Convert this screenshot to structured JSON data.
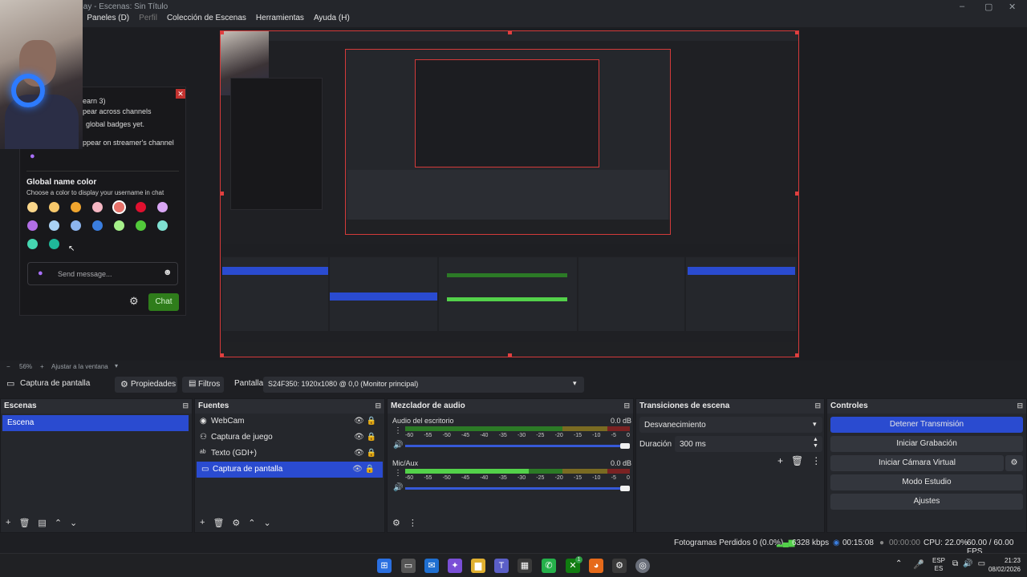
{
  "window": {
    "title_partial": "play - Escenas: Sin Título",
    "menu": [
      "ta",
      "Paneles (D)",
      "Perfil",
      "Colección de Escenas",
      "Herramientas",
      "Ayuda (H)"
    ]
  },
  "chat": {
    "lines": [
      "earn 3)",
      "pear across channels",
      "global badges yet.",
      "ppear on streamer's channel"
    ],
    "name_color_title": "Global name color",
    "name_color_desc": "Choose a color to display your username in chat",
    "swatches": [
      "#fbd78b",
      "#f7c86b",
      "#f0a52e",
      "#f6b7c3",
      "#e8726a",
      "#e0102f",
      "#d9a6f4",
      "#b26ee6",
      "#a9d2f4",
      "#8db5ee",
      "#3a7ee0",
      "#a6f08a",
      "#52c93a",
      "#7fe0d2",
      "#45d6b0",
      "#1fb89a"
    ],
    "send_placeholder": "Send message...",
    "chat_button": "Chat"
  },
  "zoom": {
    "level": "56%",
    "fit_label": "Ajustar a la ventana"
  },
  "source_bar": {
    "source_name": "Captura de pantalla",
    "properties": "Propiedades",
    "filters": "Filtros",
    "display_label": "Pantalla",
    "display_value": "S24F350: 1920x1080 @ 0,0 (Monitor principal)"
  },
  "scenes": {
    "title": "Escenas",
    "items": [
      "Escena"
    ]
  },
  "sources": {
    "title": "Fuentes",
    "items": [
      "WebCam",
      "Captura de juego",
      "Texto (GDI+)",
      "Captura de pantalla"
    ]
  },
  "mixer": {
    "title": "Mezclador de audio",
    "channels": [
      {
        "name": "Audio del escritorio",
        "db": "0.0 dB",
        "level": 0.0
      },
      {
        "name": "Mic/Aux",
        "db": "0.0 dB",
        "level": 0.55
      }
    ],
    "scale": [
      "-60",
      "-55",
      "-50",
      "-45",
      "-40",
      "-35",
      "-30",
      "-25",
      "-20",
      "-15",
      "-10",
      "-5",
      "0"
    ]
  },
  "transitions": {
    "title": "Transiciones de escena",
    "selected": "Desvanecimiento",
    "duration_label": "Duración",
    "duration_value": "300 ms"
  },
  "controls": {
    "title": "Controles",
    "stop_stream": "Detener Transmisión",
    "start_record": "Iniciar Grabación",
    "virtual_cam": "Iniciar Cámara Virtual",
    "studio_mode": "Modo Estudio",
    "settings": "Ajustes"
  },
  "status": {
    "dropped": "Fotogramas Perdidos 0 (0.0%)",
    "bitrate": "6328 kbps",
    "stream_time": "00:15:08",
    "rec_time": "00:00:00",
    "cpu": "CPU: 22.0%",
    "fps": "60.00 / 60.00 FPS"
  },
  "taskbar": {
    "lang1": "ESP",
    "lang2": "ES",
    "time": "21:23",
    "date": "08/02/2026",
    "whatsapp_badge": "1"
  },
  "colors": {
    "accent": "#2a4bd0",
    "stream_button": "#2a4bd0",
    "preview_border": "#d43a3a"
  }
}
